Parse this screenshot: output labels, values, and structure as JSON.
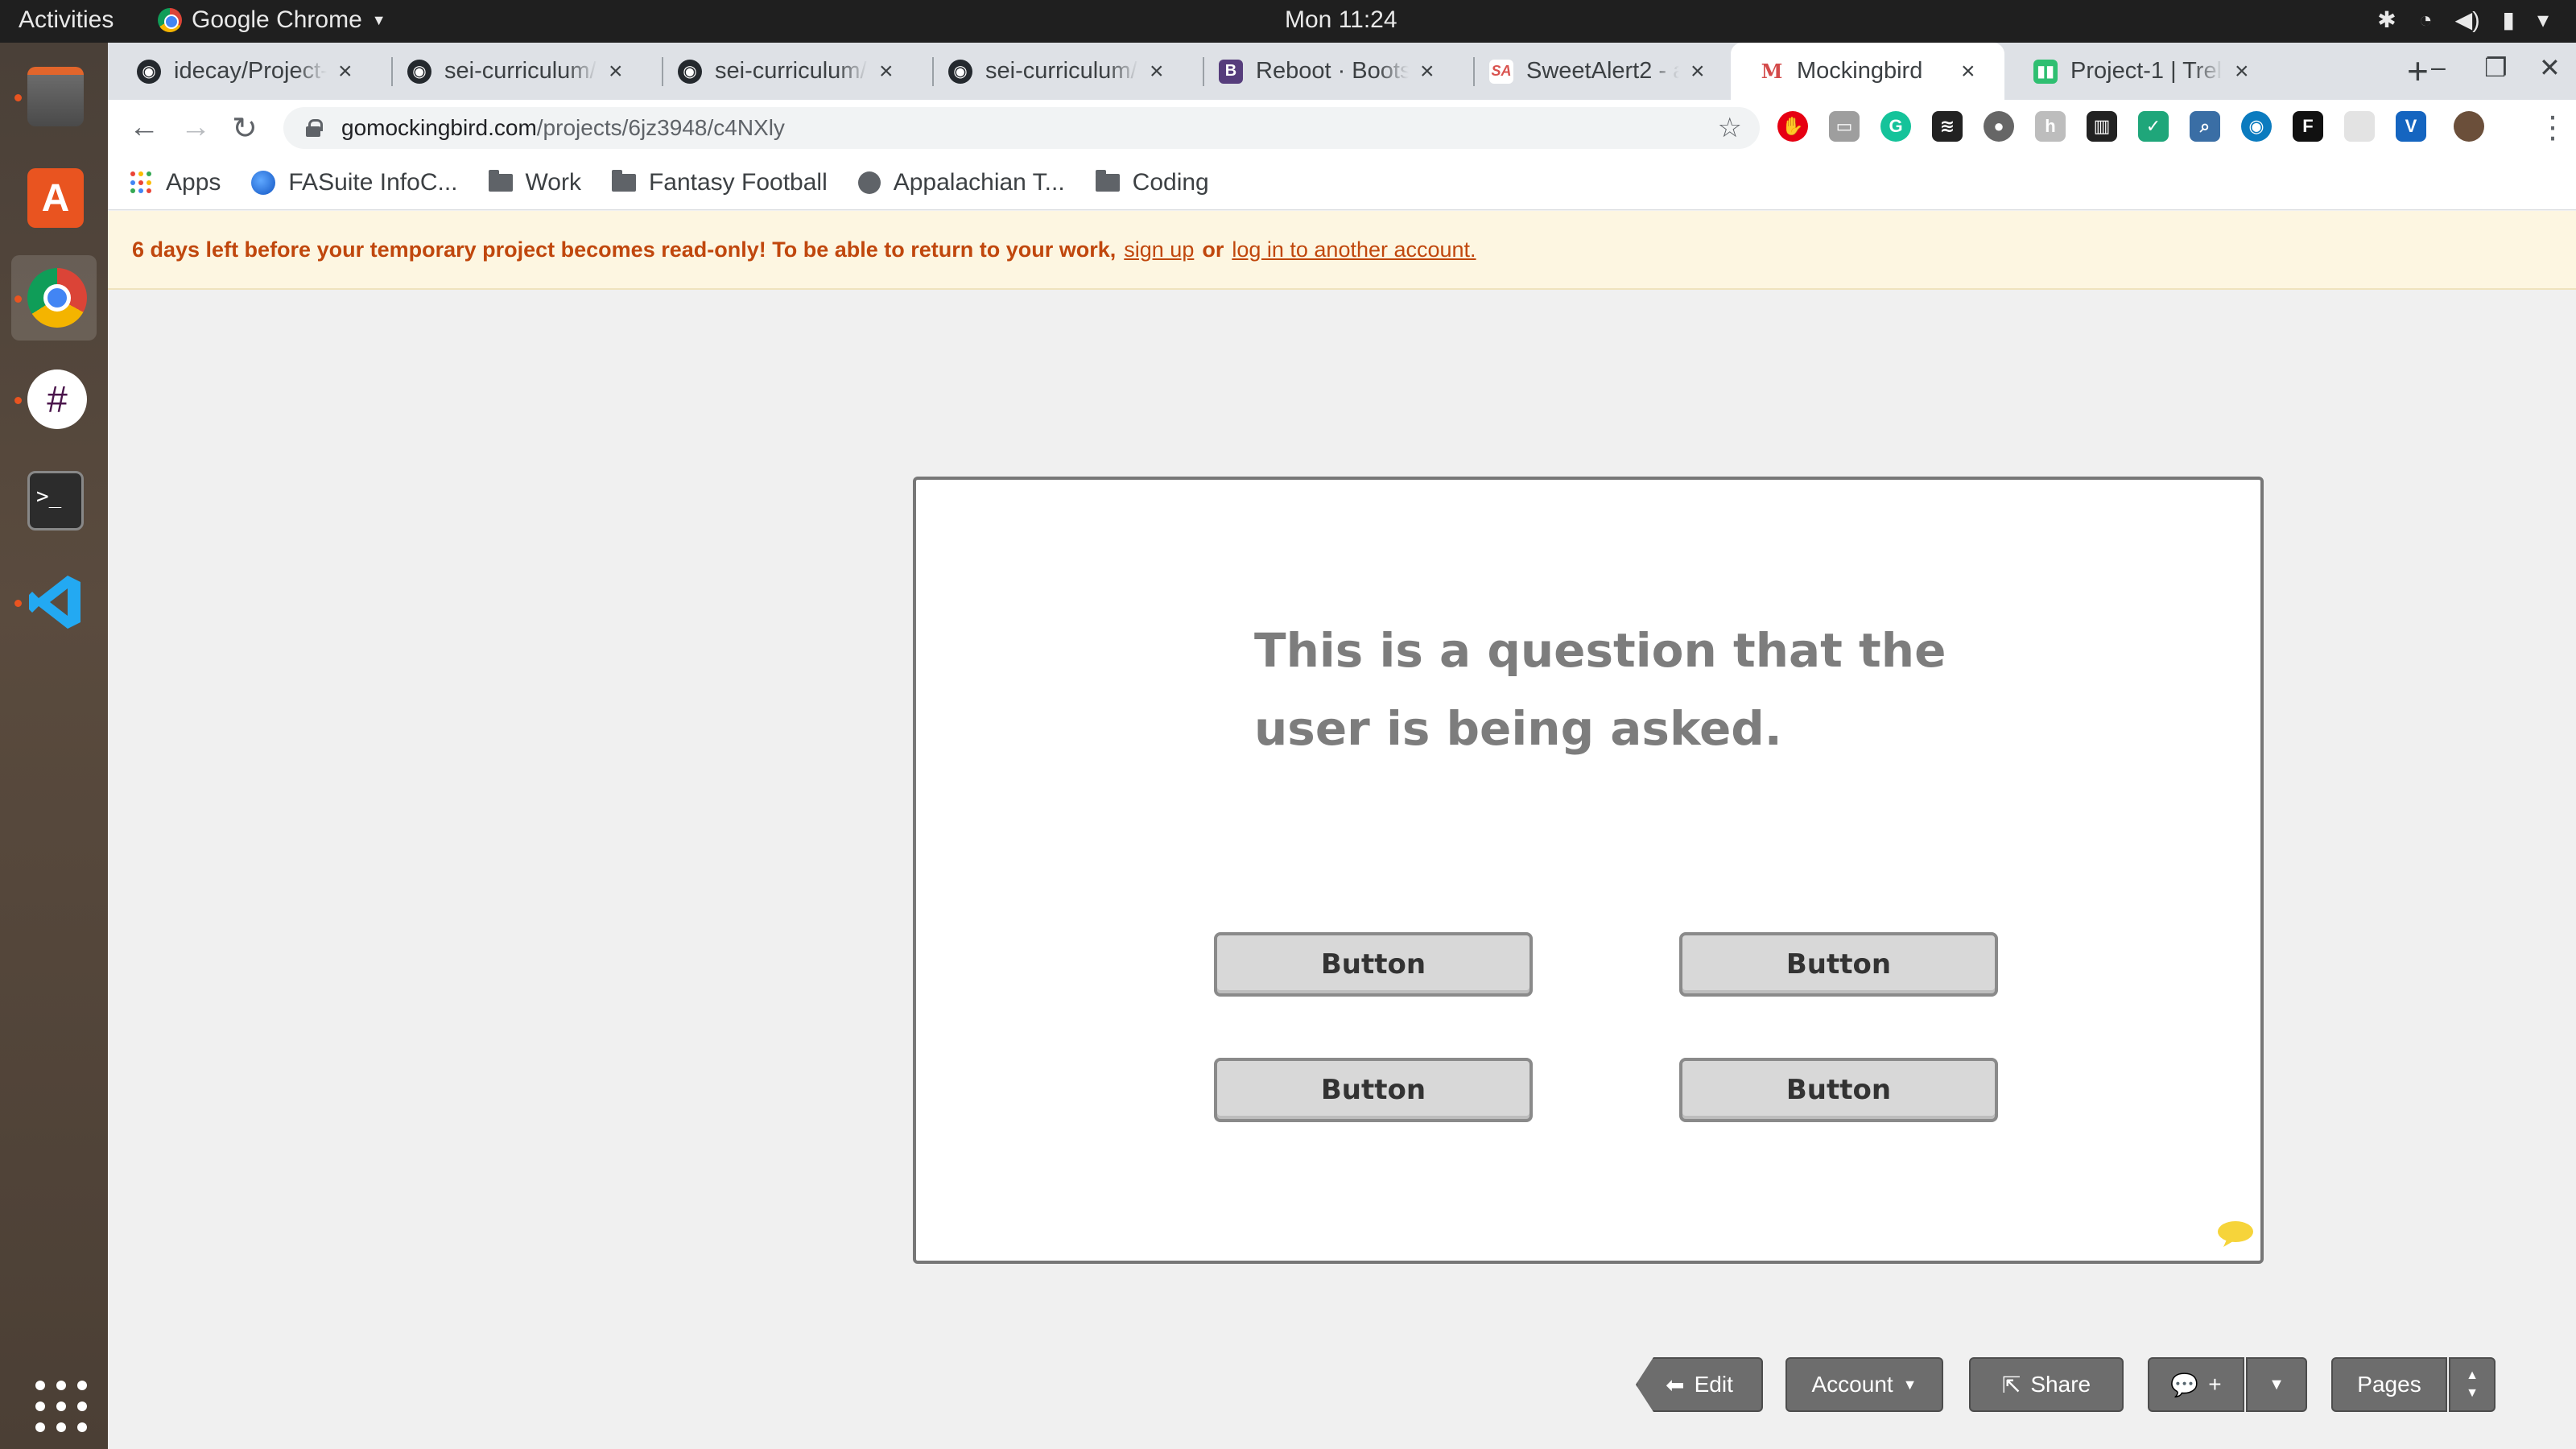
{
  "system": {
    "activities": "Activities",
    "app_name": "Google Chrome",
    "clock": "Mon 11:24"
  },
  "dock": {
    "items": [
      "file-manager",
      "software-center",
      "chrome",
      "slack",
      "terminal",
      "vscode",
      "show-apps"
    ]
  },
  "tabs": [
    {
      "title": "idecay/Project-",
      "icon": "github-icon"
    },
    {
      "title": "sei-curriculum/",
      "icon": "github-icon"
    },
    {
      "title": "sei-curriculum/",
      "icon": "github-icon"
    },
    {
      "title": "sei-curriculum/",
      "icon": "github-icon"
    },
    {
      "title": "Reboot · Boots",
      "icon": "bootstrap-icon"
    },
    {
      "title": "SweetAlert2 - a",
      "icon": "sweetalert-icon"
    },
    {
      "title": "Mockingbird",
      "icon": "mockingbird-icon",
      "active": true
    },
    {
      "title": "Project-1 | Trell",
      "icon": "trello-icon"
    }
  ],
  "address": {
    "host": "gomockingbird.com",
    "path": "/projects/6jz3948/c4NXly"
  },
  "bookmarks": [
    {
      "label": "Apps",
      "icon": "apps-icon"
    },
    {
      "label": "FASuite InfoC...",
      "icon": "fasuite-icon"
    },
    {
      "label": "Work",
      "icon": "folder-icon"
    },
    {
      "label": "Fantasy Football",
      "icon": "folder-icon"
    },
    {
      "label": "Appalachian T...",
      "icon": "globe-icon"
    },
    {
      "label": "Coding",
      "icon": "folder-icon"
    }
  ],
  "banner": {
    "message": "6 days left before your temporary project becomes read-only! To be able to return to your work,",
    "signup": "sign up",
    "or": "or",
    "login": "log in to another account."
  },
  "mockup": {
    "question": "This is a question that the user is being asked.",
    "buttons": [
      "Button",
      "Button",
      "Button",
      "Button"
    ]
  },
  "controls": {
    "edit": "Edit",
    "account": "Account",
    "share": "Share",
    "comment_plus": "+",
    "pages": "Pages"
  },
  "colors": {
    "banner_text": "#c0470d",
    "banner_bg": "#fdf6e1",
    "control_bg": "#6d6d6d"
  }
}
